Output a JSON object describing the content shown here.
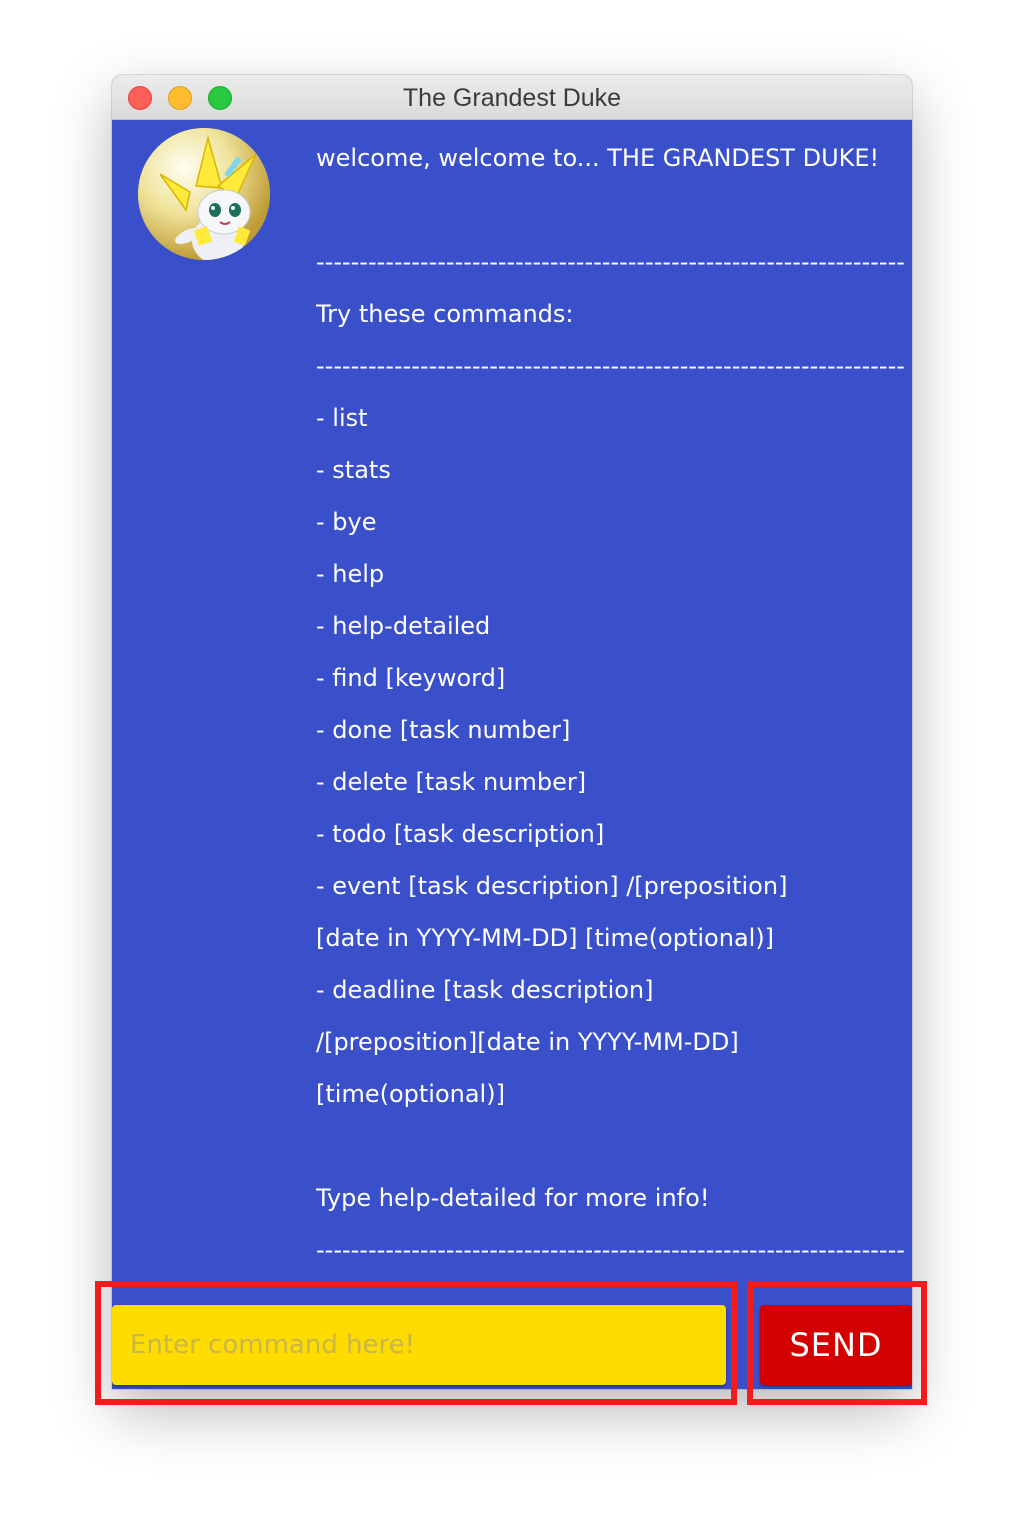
{
  "window": {
    "title": "The Grandest Duke"
  },
  "chat": {
    "message_lines": [
      "welcome, welcome to... THE GRANDEST DUKE!",
      "",
      "----------------------------------------------------------------------",
      "Try these commands:",
      "----------------------------------------------------------------------",
      "- list",
      "- stats",
      "- bye",
      "- help",
      "- help-detailed",
      "- find [keyword]",
      "- done [task number]",
      "- delete [task number]",
      "- todo [task description]",
      "- event [task description] /[preposition]",
      "[date in YYYY-MM-DD] [time(optional)]",
      "- deadline [task description]",
      "/[preposition][date in YYYY-MM-DD]",
      "[time(optional)]",
      "",
      "Type help-detailed for more info!",
      "----------------------------------------------------------------------"
    ]
  },
  "input": {
    "placeholder": "Enter command here!",
    "value": ""
  },
  "send_button": {
    "label": "SEND"
  },
  "colors": {
    "background": "#3a4fca",
    "input": "#ffdc00",
    "send": "#d40000",
    "highlight": "#f21c1c"
  },
  "icons": {
    "avatar": "jirachi-avatar-icon"
  }
}
